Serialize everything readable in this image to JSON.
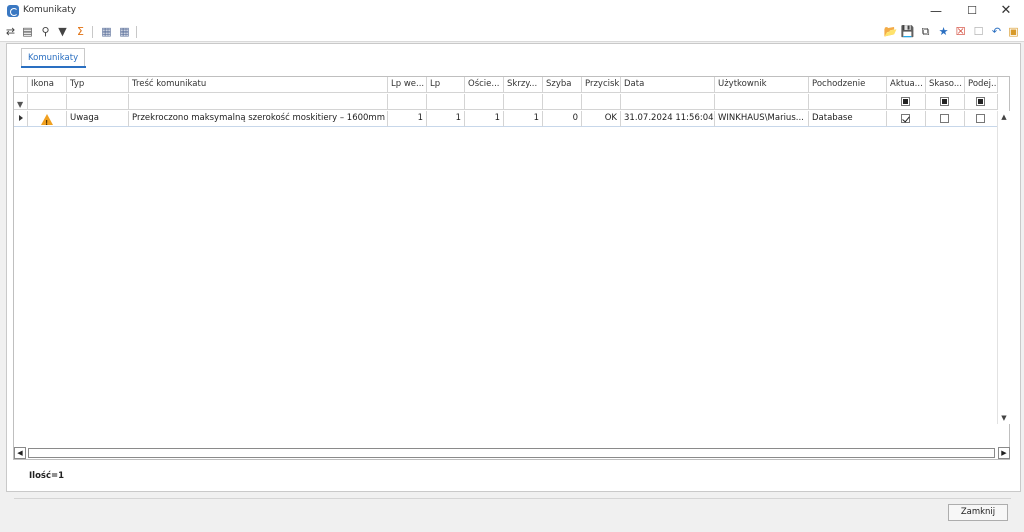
{
  "window": {
    "title": "Komunikaty"
  },
  "tab": {
    "label": "Komunikaty"
  },
  "toolbar": {
    "left_icons": [
      "export-icon",
      "form-view-icon",
      "search-icon",
      "filter-icon",
      "sum-icon",
      "columns-icon",
      "grid-icon"
    ],
    "right_icons": [
      "open-folder-icon",
      "save-icon",
      "save-as-icon",
      "favorite-star-icon",
      "delete-doc-icon",
      "doc-icon",
      "undo-icon",
      "report-icon"
    ]
  },
  "columns": [
    "Ikona",
    "Typ",
    "Treść komunikatu",
    "Lp we...",
    "Lp",
    "Oście...",
    "Skrzy...",
    "Szyba",
    "Przycisk",
    "Data",
    "Użytkownik",
    "Pochodzenie",
    "Aktua...",
    "Skaso...",
    "Podej..."
  ],
  "rows": [
    {
      "icon": "warning-icon",
      "typ": "Uwaga",
      "tresc": "Przekroczono maksymalną szerokość moskitiery – 1600mm",
      "lp_we": "1",
      "lp": "1",
      "oscie": "1",
      "skrzy": "1",
      "szyba": "0",
      "przycisk": "OK",
      "data": "31.07.2024 11:56:04",
      "uzytkownik": "WINKHAUS\\Marius...",
      "pochodzenie": "Database",
      "aktualny": true,
      "skasowany": false,
      "podjety": false
    }
  ],
  "footer": {
    "count": "Ilość=1"
  },
  "buttons": {
    "close": "Zamknij"
  },
  "colors": {
    "accent": "#2a6fc1",
    "selected_row": "#dce9f7",
    "warning": "#f0a020"
  }
}
